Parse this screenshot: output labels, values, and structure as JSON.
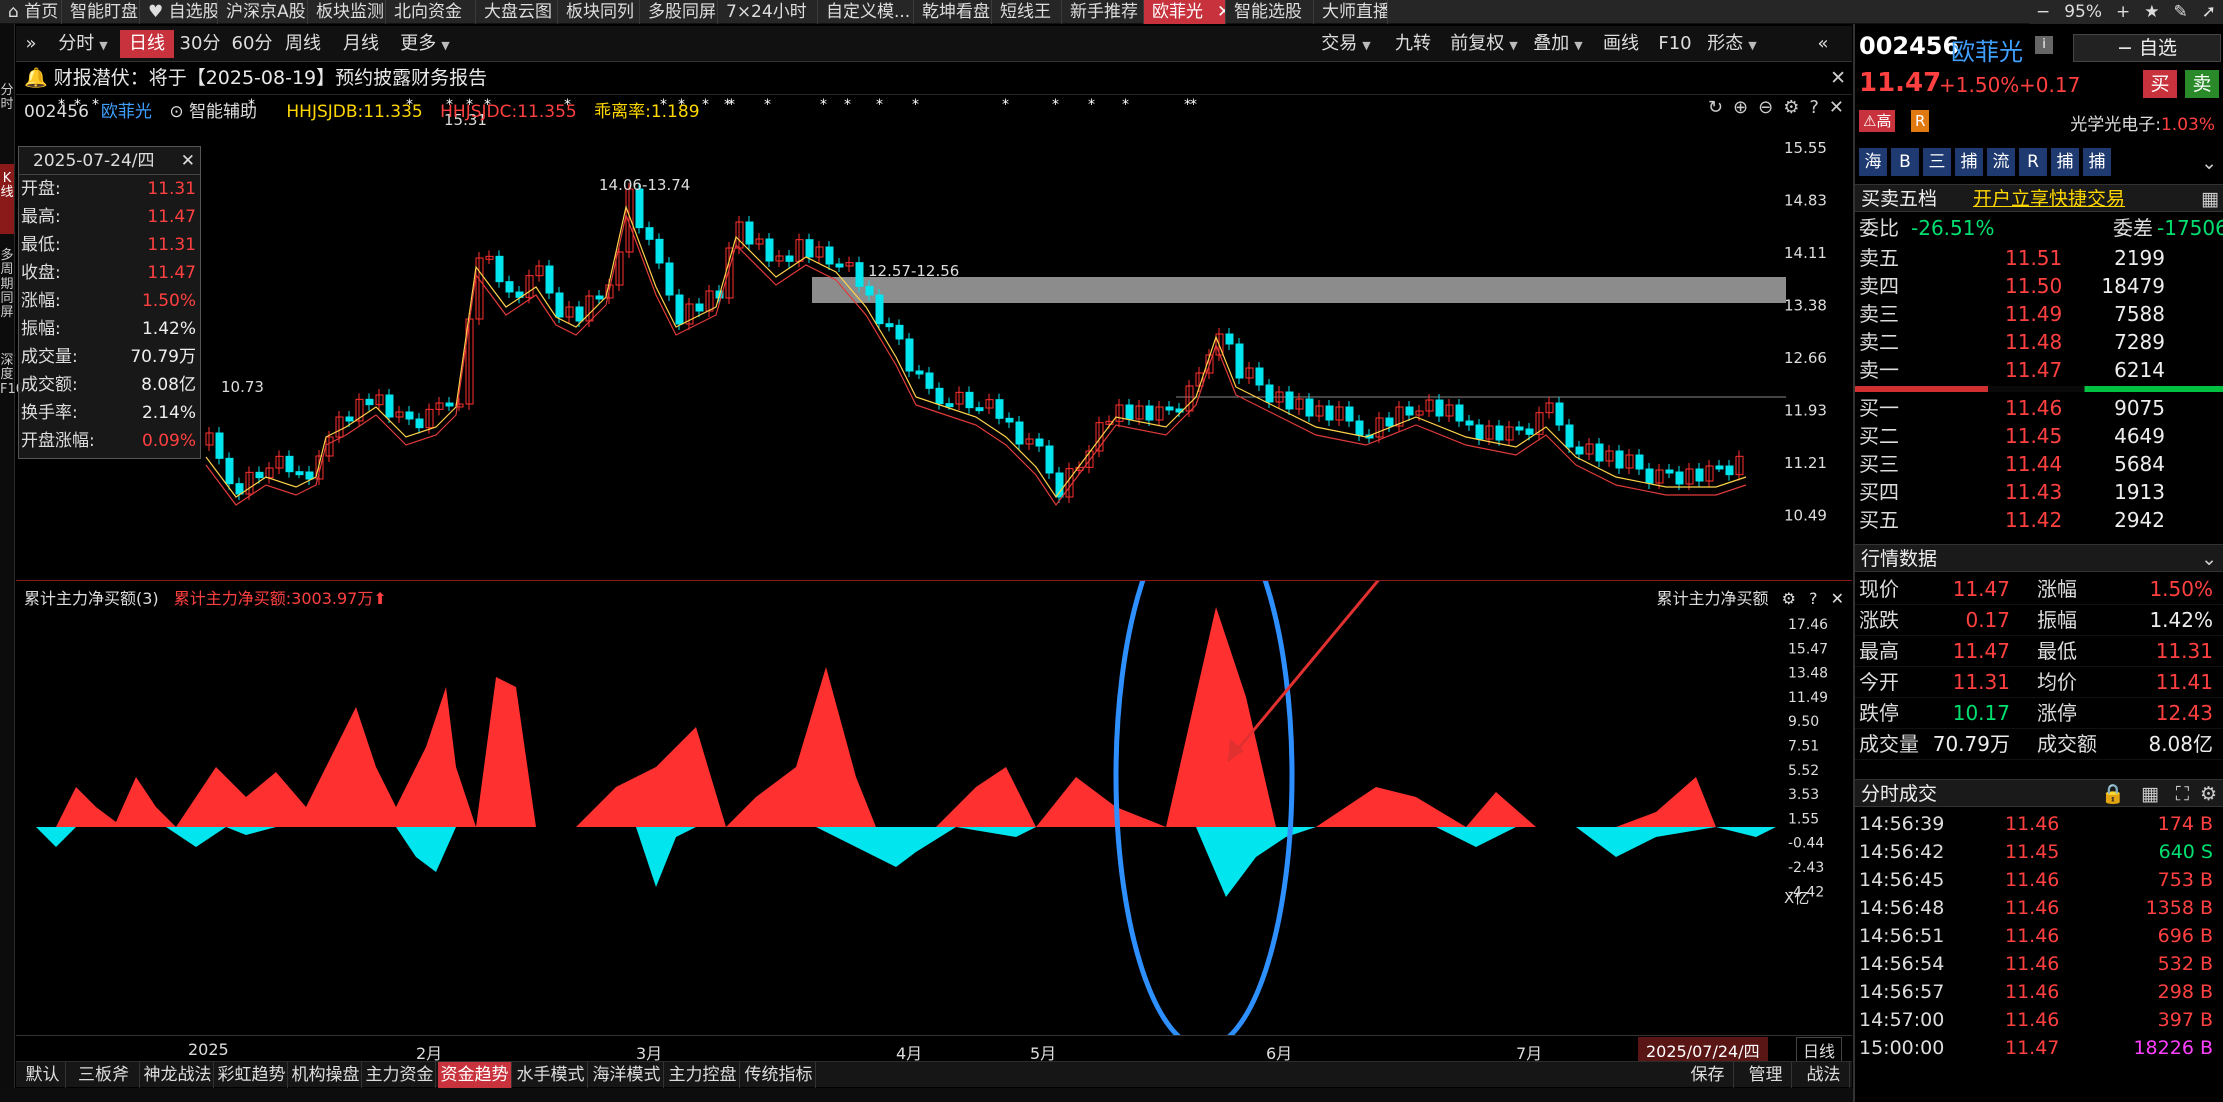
{
  "topnav": {
    "tabs": [
      "首页",
      "智能盯盘",
      "自选股",
      "沪深京A股",
      "板块监测",
      "北向资金",
      "大盘云图",
      "板块同列",
      "多股同屏",
      "7×24小时",
      "自定义模...",
      "乾坤看盘",
      "短线王",
      "新手推荐",
      "欧菲光",
      "智能选股",
      "大师直播"
    ],
    "active": "欧菲光",
    "zoom": "95%"
  },
  "toolbar": {
    "periods": [
      "分时",
      "日线",
      "30分",
      "60分",
      "周线",
      "月线",
      "更多"
    ],
    "active": "日线",
    "right": [
      "交易",
      "九转",
      "前复权",
      "叠加",
      "画线",
      "F10",
      "形态"
    ]
  },
  "notice": {
    "text": "财报潜伏：将于【2025-08-19】预约披露财务报告"
  },
  "main": {
    "code": "002456",
    "name": "欧菲光",
    "assist": "智能辅助",
    "ind1": "HHJSJDB:11.335",
    "ind2": "HHJSJDC:11.355",
    "ind3": "乖离率:1.189",
    "yaxis": [
      "15.55",
      "14.83",
      "14.11",
      "13.38",
      "12.66",
      "11.93",
      "11.21",
      "10.49"
    ],
    "annotations": {
      "high": "15.31",
      "low": "10.73",
      "zone1": "14.06-13.74",
      "zone2": "12.57-12.56"
    }
  },
  "infobox": {
    "date": "2025-07-24/四",
    "rows": [
      {
        "k": "开盘:",
        "v": "11.31",
        "c": "red"
      },
      {
        "k": "最高:",
        "v": "11.47",
        "c": "red"
      },
      {
        "k": "最低:",
        "v": "11.31",
        "c": "red"
      },
      {
        "k": "收盘:",
        "v": "11.47",
        "c": "red"
      },
      {
        "k": "涨幅:",
        "v": "1.50%",
        "c": "red"
      },
      {
        "k": "振幅:",
        "v": "1.42%",
        "c": "wht"
      },
      {
        "k": "成交量:",
        "v": "70.79万",
        "c": "wht"
      },
      {
        "k": "成交额:",
        "v": "8.08亿",
        "c": "wht"
      },
      {
        "k": "换手率:",
        "v": "2.14%",
        "c": "wht"
      },
      {
        "k": "开盘涨幅:",
        "v": "0.09%",
        "c": "red"
      }
    ]
  },
  "sub": {
    "title": "累计主力净买额(3)",
    "value": "累计主力净买额:3003.97万",
    "right_label": "累计主力净买额",
    "yaxis": [
      "17.46",
      "15.47",
      "13.48",
      "11.49",
      "9.50",
      "7.51",
      "5.52",
      "3.53",
      "1.55",
      "-0.44",
      "-2.43",
      "-4.42"
    ],
    "unit": "X亿"
  },
  "xaxis": {
    "labels": [
      "2025",
      "2月",
      "3月",
      "4月",
      "5月",
      "6月",
      "7月"
    ],
    "current": "2025/07/24/四",
    "period": "日线"
  },
  "bottom_tabs": [
    "默认",
    "三板斧",
    "神龙战法",
    "彩虹趋势",
    "机构操盘",
    "主力资金",
    "资金趋势",
    "水手模式",
    "海洋模式",
    "主力控盘",
    "传统指标"
  ],
  "bottom_active": "资金趋势",
  "bottom_right": [
    "保存",
    "管理",
    "战法"
  ],
  "left_strip": [
    "分时",
    "K线",
    "多周期同屏",
    "深度F10"
  ],
  "right": {
    "code": "002456",
    "name": "欧菲光",
    "add_fav": "自选",
    "price": "11.47",
    "pct": "+1.50%",
    "chg": "+0.17",
    "buy": "买",
    "sell": "卖",
    "tags": [
      "高",
      "R"
    ],
    "sector": "光学光电子:",
    "sector_pct": "1.03%",
    "icons": [
      "海",
      "B",
      "三",
      "捕",
      "流",
      "R",
      "捕",
      "捕"
    ],
    "ob_title": "买卖五档",
    "ob_link": "开户立享快捷交易",
    "weibi": "委比",
    "weibi_v": "-26.51%",
    "weicha": "委差",
    "weicha_v": "-17506",
    "asks": [
      {
        "k": "卖五",
        "p": "11.51",
        "v": "2199"
      },
      {
        "k": "卖四",
        "p": "11.50",
        "v": "18479"
      },
      {
        "k": "卖三",
        "p": "11.49",
        "v": "7588"
      },
      {
        "k": "卖二",
        "p": "11.48",
        "v": "7289"
      },
      {
        "k": "卖一",
        "p": "11.47",
        "v": "6214"
      }
    ],
    "bids": [
      {
        "k": "买一",
        "p": "11.46",
        "v": "9075"
      },
      {
        "k": "买二",
        "p": "11.45",
        "v": "4649"
      },
      {
        "k": "买三",
        "p": "11.44",
        "v": "5684"
      },
      {
        "k": "买四",
        "p": "11.43",
        "v": "1913"
      },
      {
        "k": "买五",
        "p": "11.42",
        "v": "2942"
      }
    ],
    "quote_title": "行情数据",
    "quotes": [
      {
        "k1": "现价",
        "v1": "11.47",
        "c1": "red",
        "k2": "涨幅",
        "v2": "1.50%",
        "c2": "red"
      },
      {
        "k1": "涨跌",
        "v1": "0.17",
        "c1": "red",
        "k2": "振幅",
        "v2": "1.42%",
        "c2": "white"
      },
      {
        "k1": "最高",
        "v1": "11.47",
        "c1": "red",
        "k2": "最低",
        "v2": "11.31",
        "c2": "red"
      },
      {
        "k1": "今开",
        "v1": "11.31",
        "c1": "red",
        "k2": "均价",
        "v2": "11.41",
        "c2": "red"
      },
      {
        "k1": "跌停",
        "v1": "10.17",
        "c1": "green",
        "k2": "涨停",
        "v2": "12.43",
        "c2": "red"
      },
      {
        "k1": "成交量",
        "v1": "70.79万",
        "c1": "white",
        "k2": "成交额",
        "v2": "8.08亿",
        "c2": "white"
      }
    ],
    "ticks_title": "分时成交",
    "ticks": [
      {
        "t": "14:56:39",
        "p": "11.46",
        "v": "174 B",
        "c": "red"
      },
      {
        "t": "14:56:42",
        "p": "11.45",
        "v": "640 S",
        "c": "green"
      },
      {
        "t": "14:56:45",
        "p": "11.46",
        "v": "753 B",
        "c": "red"
      },
      {
        "t": "14:56:48",
        "p": "11.46",
        "v": "1358 B",
        "c": "red"
      },
      {
        "t": "14:56:51",
        "p": "11.46",
        "v": "696 B",
        "c": "red"
      },
      {
        "t": "14:56:54",
        "p": "11.46",
        "v": "532 B",
        "c": "red"
      },
      {
        "t": "14:56:57",
        "p": "11.46",
        "v": "298 B",
        "c": "red"
      },
      {
        "t": "14:57:00",
        "p": "11.46",
        "v": "397 B",
        "c": "red"
      },
      {
        "t": "15:00:00",
        "p": "11.47",
        "v": "18226 B",
        "c": "magenta"
      }
    ]
  },
  "colors": {
    "up": "#ff3030",
    "down": "#00e5ee",
    "accent": "#c8323c",
    "ellipse": "#2e90ff"
  }
}
